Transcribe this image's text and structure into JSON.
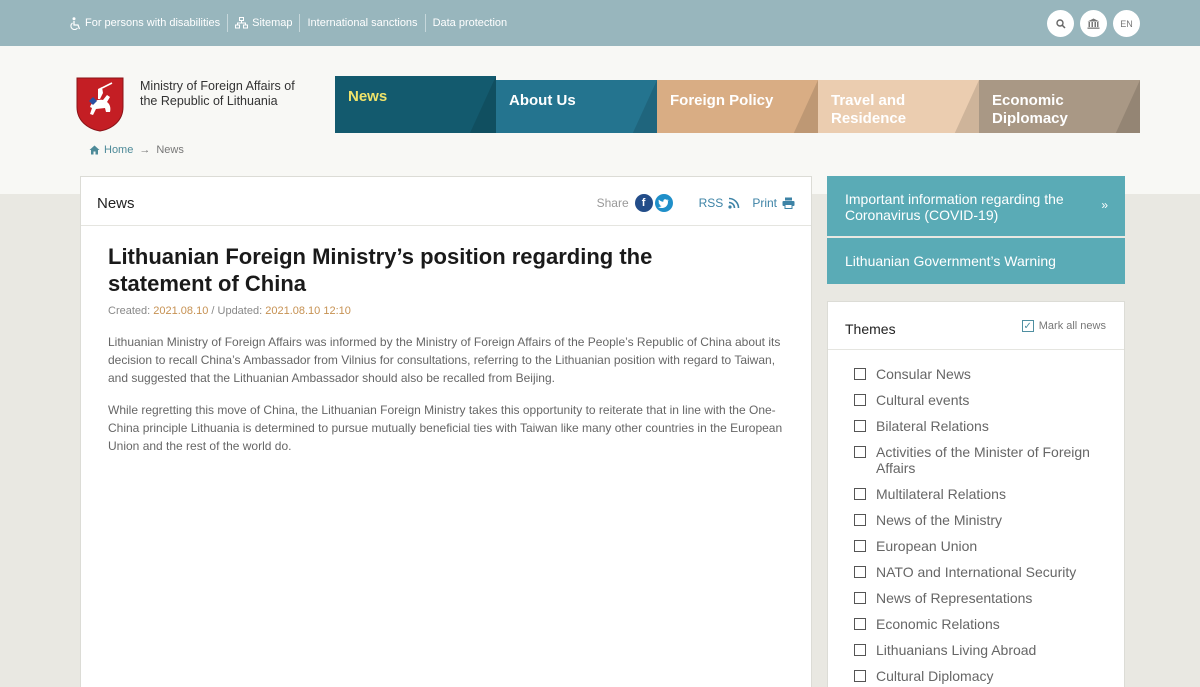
{
  "topbar": {
    "links": [
      {
        "label": "For persons with disabilities",
        "icon": "accessibility-icon"
      },
      {
        "label": "Sitemap",
        "icon": "sitemap-icon"
      },
      {
        "label": "International sanctions"
      },
      {
        "label": "Data protection"
      }
    ],
    "search_icon": "search-icon",
    "institution_icon": "institution-icon",
    "language": "EN"
  },
  "header": {
    "ministry_name": "Ministry of Foreign Affairs of the Republic of Lithuania",
    "nav": [
      {
        "label": "News",
        "active": true
      },
      {
        "label": "About Us"
      },
      {
        "label": "Foreign Policy"
      },
      {
        "label": "Travel and Residence"
      },
      {
        "label": "Economic Diplomacy"
      }
    ]
  },
  "breadcrumb": {
    "home": "Home",
    "separator": "→",
    "current": "News"
  },
  "main": {
    "section_title": "News",
    "share_label": "Share",
    "rss_label": "RSS",
    "print_label": "Print",
    "article": {
      "title": "Lithuanian Foreign Ministry’s position regarding the statement of China",
      "created_label": "Created:",
      "created": "2021.08.10",
      "updated_label": "/ Updated:",
      "updated": "2021.08.10 12:10",
      "paragraphs": [
        "Lithuanian Ministry of Foreign Affairs was informed by the Ministry of Foreign Affairs of the People’s Republic of China about its decision to recall China’s Ambassador from Vilnius for consultations, referring to the Lithuanian position with regard to Taiwan, and suggested that the Lithuanian Ambassador should also be recalled from Beijing.",
        "While regretting this move of China, the Lithuanian Foreign Ministry takes this opportunity to reiterate that in line with the One-China principle Lithuania is determined to pursue mutually beneficial ties with Taiwan like many other countries in the European Union and the rest of the world do."
      ]
    }
  },
  "sidebar": {
    "notices": [
      {
        "label": "Important information regarding the Coronavirus (COVID-19)",
        "arrow": "»"
      },
      {
        "label": "Lithuanian Government’s Warning"
      }
    ],
    "themes": {
      "title": "Themes",
      "mark_all": "Mark all news",
      "items": [
        "Consular News",
        "Cultural events",
        "Bilateral Relations",
        "Activities of the Minister of Foreign Affairs",
        "Multilateral Relations",
        "News of the Ministry",
        "European Union",
        "NATO and International Security",
        "News of Representations",
        "Economic Relations",
        "Lithuanians Living Abroad",
        "Cultural Diplomacy"
      ]
    }
  },
  "colors": {
    "topbar": "#98b6bd",
    "nav_news": "#135a6e",
    "nav_about": "#24748f",
    "nav_policy": "#d9ad84",
    "nav_travel": "#ebcdb0",
    "nav_econ": "#a99885",
    "notice": "#5aabb6",
    "date_accent": "#c69152"
  }
}
